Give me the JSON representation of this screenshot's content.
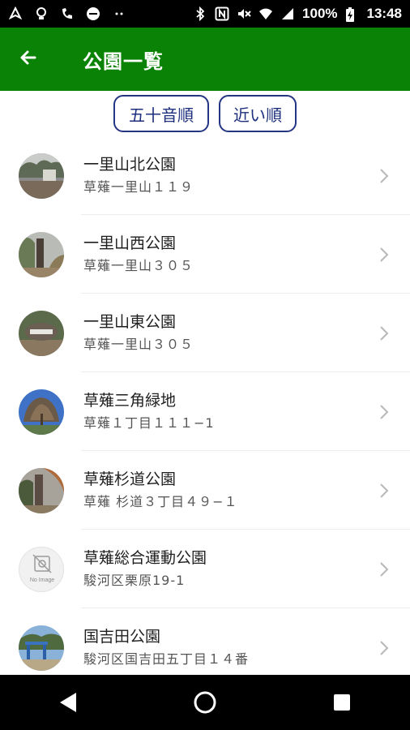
{
  "status_bar": {
    "battery_percent": "100%",
    "time": "13:48"
  },
  "app_bar": {
    "title": "公園一覧"
  },
  "sort_buttons": {
    "alphabetical": "五十音順",
    "nearest": "近い順"
  },
  "parks": [
    {
      "name": "一里山北公園",
      "address": "草薙一里山１１９",
      "image": "park-photo-1"
    },
    {
      "name": "一里山西公園",
      "address": "草薙一里山３０５",
      "image": "park-photo-2"
    },
    {
      "name": "一里山東公園",
      "address": "草薙一里山３０５",
      "image": "park-photo-3"
    },
    {
      "name": "草薙三角緑地",
      "address": "草薙１丁目１１１−1",
      "image": "park-photo-4"
    },
    {
      "name": "草薙杉道公園",
      "address": "草薙 杉道３丁目４９−１",
      "image": "park-photo-5"
    },
    {
      "name": "草薙総合運動公園",
      "address": "駿河区栗原19-1",
      "image": "no-image",
      "no_image_label": "No Image"
    },
    {
      "name": "国吉田公園",
      "address": "駿河区国吉田五丁目１４番",
      "image": "park-photo-7"
    }
  ]
}
